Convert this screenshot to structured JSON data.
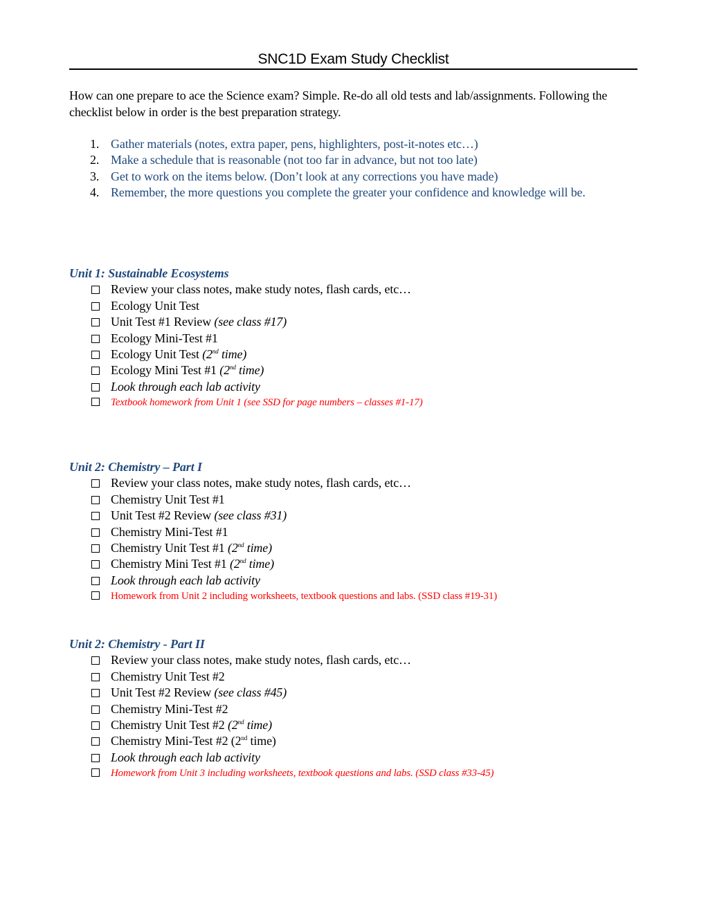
{
  "document": {
    "title": "SNC1D Exam Study Checklist",
    "intro": "How can one prepare to ace the Science exam?  Simple.  Re-do all old tests and lab/assignments. Following the checklist below in order is the best preparation strategy.",
    "steps": [
      {
        "num": "1.",
        "text": "Gather materials (notes, extra paper, pens, highlighters, post-it-notes etc…)"
      },
      {
        "num": "2.",
        "text": "Make a schedule that is reasonable (not too far in advance, but not too late)"
      },
      {
        "num": "3.",
        "text": "Get to work on the items below. (Don’t look at any corrections you have made)"
      },
      {
        "num": "4.",
        "text": "Remember, the more questions you complete the greater your confidence and knowledge will be."
      }
    ],
    "colors": {
      "heading_blue": "#1f497d",
      "homework_red": "#ff0000",
      "text": "#000000"
    }
  },
  "sections": [
    {
      "heading": "Unit 1:  Sustainable Ecosystems",
      "items": [
        {
          "text": "Review your class notes, make study notes, flash cards, etc…",
          "checked": false
        },
        {
          "text": "Ecology Unit Test",
          "checked": false
        },
        {
          "text": "Unit Test #1 Review ",
          "note": "(see class #17)",
          "checked": false
        },
        {
          "text": "Ecology Mini-Test #1",
          "checked": false
        },
        {
          "text": "Ecology Unit Test ",
          "note_pre": "(2",
          "note_sup": "nd",
          "note_post": " time)",
          "checked": false
        },
        {
          "text": "Ecology Mini Test #1 ",
          "note_pre": "(2",
          "note_sup": "nd",
          "note_post": " time)",
          "checked": false
        },
        {
          "text": "Look through each lab activity",
          "checked": false
        },
        {
          "text": "Textbook homework from Unit 1 (see SSD for page numbers – classes #1-17)",
          "checked": false
        }
      ]
    },
    {
      "heading": "Unit 2:  Chemistry – Part I",
      "items": [
        {
          "text": "Review your class notes, make study notes, flash cards, etc…",
          "checked": false
        },
        {
          "text": "Chemistry Unit Test #1",
          "checked": false
        },
        {
          "text": "Unit Test #2 Review ",
          "note": "(see class #31)",
          "checked": false
        },
        {
          "text": "Chemistry Mini-Test #1",
          "checked": false
        },
        {
          "text": "Chemistry Unit Test #1 ",
          "note_pre": "(2",
          "note_sup": "nd",
          "note_post": " time)",
          "checked": false
        },
        {
          "text": "Chemistry Mini Test #1 ",
          "note_pre": "(2",
          "note_sup": "nd",
          "note_post": " time)",
          "checked": false
        },
        {
          "text": "Look through each lab activity",
          "checked": false
        },
        {
          "text": "Homework from Unit 2 including worksheets, textbook questions and labs. (SSD class #19-31)",
          "checked": false
        }
      ]
    },
    {
      "heading": "Unit 2:  Chemistry - Part II",
      "items": [
        {
          "text": "Review your class notes, make study notes, flash cards, etc…",
          "checked": false
        },
        {
          "text": "Chemistry Unit Test #2",
          "checked": false
        },
        {
          "text": "Unit Test #2 Review ",
          "note": "(see class #45)",
          "checked": false
        },
        {
          "text": "Chemistry Mini-Test #2",
          "checked": false
        },
        {
          "text": "Chemistry Unit Test #2 ",
          "note_pre": "(2",
          "note_sup": "nd",
          "note_post": " time)",
          "checked": false
        },
        {
          "text": "Chemistry Mini-Test #2 (2",
          "sup": "nd",
          "text_post": " time)",
          "checked": false
        },
        {
          "text": "Look through each lab activity",
          "checked": false
        },
        {
          "text": "Homework from Unit 3 including worksheets, textbook questions and labs. (SSD class #33-45)",
          "checked": false
        }
      ]
    }
  ]
}
